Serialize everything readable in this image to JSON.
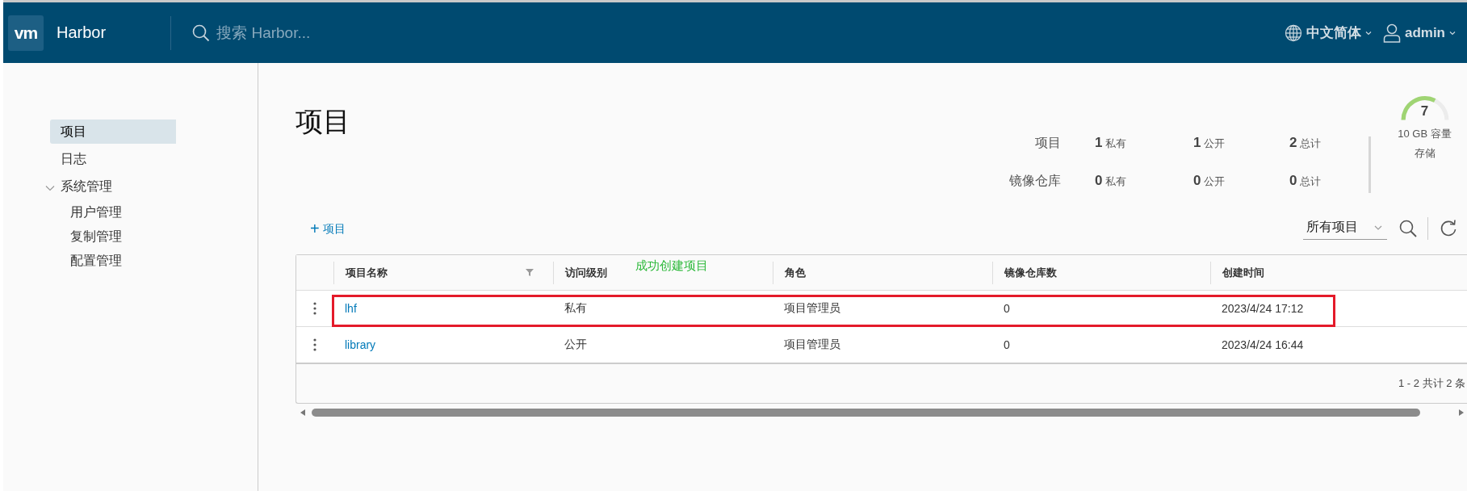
{
  "header": {
    "logo": "vm",
    "title": "Harbor",
    "search": {
      "placeholder": "搜索 Harbor..."
    },
    "language": "中文简体",
    "user": "admin"
  },
  "sidebar": {
    "items": [
      {
        "label": "项目",
        "selected": true
      },
      {
        "label": "日志",
        "selected": false
      },
      {
        "label": "系统管理",
        "selected": false,
        "expanded": true,
        "children": [
          {
            "label": "用户管理",
            "selected": false
          },
          {
            "label": "复制管理",
            "selected": false
          },
          {
            "label": "配置管理",
            "selected": false
          }
        ]
      }
    ]
  },
  "page_title": "项目",
  "summary": {
    "rows": [
      {
        "label": "项目",
        "stats": [
          {
            "value": "1",
            "unit": "私有"
          },
          {
            "value": "1",
            "unit": "公开"
          },
          {
            "value": "2",
            "unit": "总计"
          }
        ]
      },
      {
        "label": "镜像仓库",
        "stats": [
          {
            "value": "0",
            "unit": "私有"
          },
          {
            "value": "0",
            "unit": "公开"
          },
          {
            "value": "0",
            "unit": "总计"
          }
        ]
      }
    ],
    "storage": {
      "value": "7",
      "level": 0.65,
      "capacity": "10 GB 容量",
      "label": "存储"
    }
  },
  "new_project_button": {
    "icon": "+",
    "label": "项目"
  },
  "filter": {
    "value": "所有项目"
  },
  "table": {
    "columns": [
      {
        "label": "项目名称",
        "filter": true
      },
      {
        "label": "访问级别",
        "filter": false
      },
      {
        "label": "角色",
        "filter": false
      },
      {
        "label": "镜像仓库数",
        "filter": false
      },
      {
        "label": "创建时间",
        "filter": false
      }
    ],
    "rows": [
      {
        "name": "lhf",
        "access": "私有",
        "role": "项目管理员",
        "repo_count": "0",
        "created": "2023/4/24 17:12",
        "highlighted": true
      },
      {
        "name": "library",
        "access": "公开",
        "role": "项目管理员",
        "repo_count": "0",
        "created": "2023/4/24 16:44",
        "highlighted": false
      }
    ],
    "footer": "1 - 2 共计 2 条"
  },
  "annotation": {
    "text": "成功创建项目"
  }
}
